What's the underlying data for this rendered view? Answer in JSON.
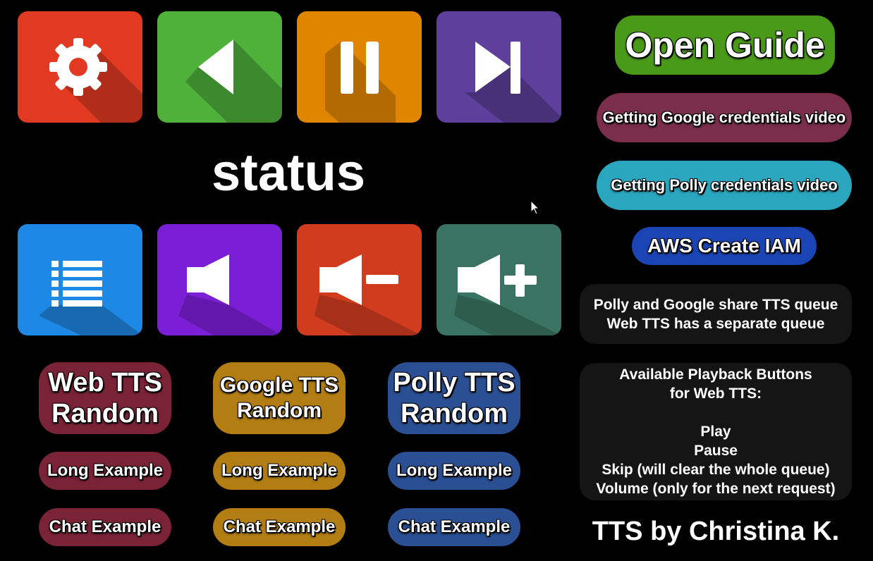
{
  "tiles_top": [
    {
      "name": "settings",
      "icon": "gear-icon",
      "color": "#e23a22"
    },
    {
      "name": "play",
      "icon": "play-icon",
      "color": "#4fb03a"
    },
    {
      "name": "pause",
      "icon": "pause-icon",
      "color": "#e08500"
    },
    {
      "name": "skip",
      "icon": "skip-icon",
      "color": "#5e3f9c"
    }
  ],
  "tiles_bottom": [
    {
      "name": "queue-list",
      "icon": "list-icon",
      "color": "#1e88e5"
    },
    {
      "name": "mute",
      "icon": "speaker-icon",
      "color": "#7a1fd6"
    },
    {
      "name": "volume-down",
      "icon": "volume-minus-icon",
      "color": "#d13c1f"
    },
    {
      "name": "volume-up",
      "icon": "volume-plus-icon",
      "color": "#3a7361"
    }
  ],
  "status_text": "status",
  "right": {
    "open_guide": "Open Guide",
    "google_video": "Getting Google credentials video",
    "polly_video": "Getting Polly credentials video",
    "aws_iam": "AWS Create IAM",
    "queue_info": [
      "Polly and Google share TTS queue",
      "Web TTS has a separate queue"
    ],
    "playback_info": [
      "Available Playback Buttons",
      "for Web TTS:",
      "",
      "Play",
      "Pause",
      "Skip (will clear the whole queue)",
      "Volume (only for the next request)"
    ],
    "credit": "TTS by Christina K."
  },
  "tts_columns": [
    {
      "random": [
        "Web TTS",
        "Random"
      ],
      "long": "Long Example",
      "chat": "Chat Example",
      "color": "#7a2236"
    },
    {
      "random": [
        "Google TTS",
        "Random"
      ],
      "long": "Long Example",
      "chat": "Chat Example",
      "color": "#b27e13"
    },
    {
      "random": [
        "Polly TTS",
        "Random"
      ],
      "long": "Long Example",
      "chat": "Chat Example",
      "color": "#2a4f92"
    }
  ],
  "colors": {
    "open_guide": "#4a9a1a",
    "google_video": "#7a2e4a",
    "polly_video": "#2aa6be",
    "aws_iam": "#1b45b4",
    "info_bg": "#151515"
  }
}
